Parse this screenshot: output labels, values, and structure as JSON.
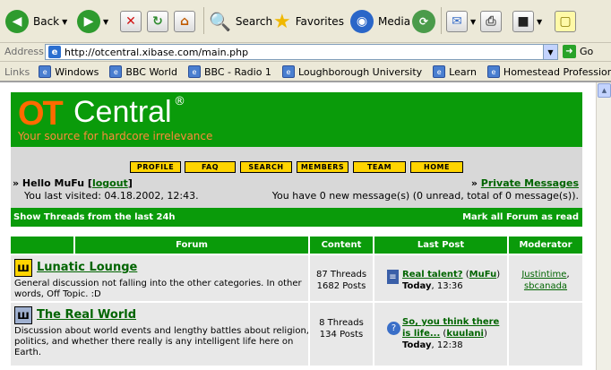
{
  "toolbar": {
    "back": "Back",
    "search": "Search",
    "favorites": "Favorites",
    "media": "Media"
  },
  "address": {
    "label": "Address",
    "url": "http://otcentral.xibase.com/main.php",
    "go": "Go"
  },
  "links": {
    "label": "Links",
    "items": [
      {
        "label": "Windows"
      },
      {
        "label": "BBC World"
      },
      {
        "label": "BBC - Radio 1"
      },
      {
        "label": "Loughborough University"
      },
      {
        "label": "Learn"
      },
      {
        "label": "Homestead Professional"
      }
    ]
  },
  "site": {
    "logo_ot": "OT",
    "logo_central": "Central",
    "logo_reg": "®",
    "tagline": "Your source for hardcore irrelevance",
    "nav": [
      "PROFILE",
      "FAQ",
      "SEARCH",
      "MEMBERS",
      "TEAM",
      "HOME"
    ]
  },
  "welcome": {
    "hello": "» Hello MuFu [",
    "logout": "logout",
    "hello_end": "]",
    "visited": "You last visited: 04.18.2002, 12:43.",
    "pm_prefix": "» ",
    "pm_link": "Private Messages",
    "messages": "You have 0 new message(s) (0 unread, total of 0 message(s))."
  },
  "greenbar": {
    "left": "Show Threads from the last 24h",
    "right": "Mark all Forum as read"
  },
  "table": {
    "headers": {
      "forum": "Forum",
      "content": "Content",
      "last_post": "Last Post",
      "moderator": "Moderator"
    },
    "rows": [
      {
        "title": "Lunatic Lounge",
        "desc": "General discussion not falling into the other categories. In other words, Off Topic. :D",
        "threads": "87 Threads",
        "posts": "1682 Posts",
        "lp_title": "Real talent?",
        "lp_user": "MuFu",
        "lp_day": "Today",
        "lp_time": ", 13:36",
        "mods": [
          "Justintime",
          "sbcanada"
        ]
      },
      {
        "title": "The Real World",
        "desc": "Discussion about world events and lengthy battles about religion, politics, and whether there really is any intelligent life here on Earth.",
        "threads": "8 Threads",
        "posts": "134 Posts",
        "lp_title": "So, you think there is life...",
        "lp_user": "kuulani",
        "lp_day": "Today",
        "lp_time": ", 12:38",
        "mods": []
      }
    ]
  }
}
